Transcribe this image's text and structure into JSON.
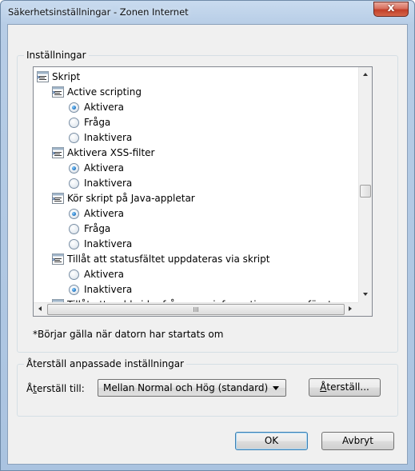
{
  "window": {
    "title": "Säkerhetsinställningar - Zonen Internet",
    "close_glyph": "x"
  },
  "settings_group": {
    "legend": "Inställningar",
    "tree": [
      {
        "type": "category",
        "label": "Skript",
        "indent": 0
      },
      {
        "type": "category",
        "label": "Active scripting",
        "indent": 1
      },
      {
        "type": "radio",
        "label": "Aktivera",
        "checked": true
      },
      {
        "type": "radio",
        "label": "Fråga",
        "checked": false
      },
      {
        "type": "radio",
        "label": "Inaktivera",
        "checked": false
      },
      {
        "type": "category",
        "label": "Aktivera XSS-filter",
        "indent": 1
      },
      {
        "type": "radio",
        "label": "Aktivera",
        "checked": true
      },
      {
        "type": "radio",
        "label": "Inaktivera",
        "checked": false
      },
      {
        "type": "category",
        "label": "Kör skript på Java-appletar",
        "indent": 1
      },
      {
        "type": "radio",
        "label": "Aktivera",
        "checked": true
      },
      {
        "type": "radio",
        "label": "Fråga",
        "checked": false
      },
      {
        "type": "radio",
        "label": "Inaktivera",
        "checked": false
      },
      {
        "type": "category",
        "label": "Tillåt att statusfältet uppdateras via skript",
        "indent": 1
      },
      {
        "type": "radio",
        "label": "Aktivera",
        "checked": false
      },
      {
        "type": "radio",
        "label": "Inaktivera",
        "checked": true
      },
      {
        "type": "category",
        "label": "Tillåt att webbsidor frågar om information genom fönster som",
        "indent": 1
      }
    ],
    "note": "*Börjar gälla när datorn har startats om"
  },
  "reset_group": {
    "legend": "Återställ anpassade inställningar",
    "label_prefix": "Å",
    "label_u": "t",
    "label_rest": "erställ till:",
    "select_value": "Mellan Normal och Hög (standard)",
    "reset_button_u": "Å",
    "reset_button_rest": "terställ..."
  },
  "buttons": {
    "ok": "OK",
    "cancel": "Avbryt"
  },
  "scrollbar": {
    "h_grip": "III"
  },
  "colors": {
    "radio_checked": "#2a7ec8",
    "title_bg": "#b7cde6",
    "close_red": "#c23f28"
  }
}
